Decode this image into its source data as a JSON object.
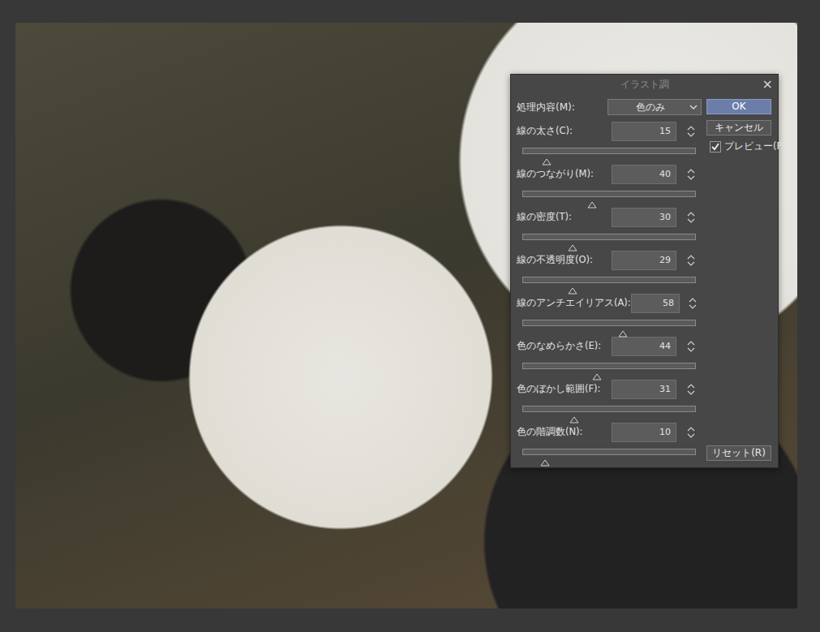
{
  "window": {
    "title": "イラスト調",
    "close": "×"
  },
  "mode": {
    "label": "処理内容(M):",
    "value": "色のみ"
  },
  "sliders": [
    {
      "label": "線の太さ(C):",
      "value": "15",
      "level": 0.14
    },
    {
      "label": "線のつながり(M):",
      "value": "40",
      "level": 0.4
    },
    {
      "label": "線の密度(T):",
      "value": "30",
      "level": 0.29
    },
    {
      "label": "線の不透明度(O):",
      "value": "29",
      "level": 0.29
    },
    {
      "label": "線のアンチエイリアス(A):",
      "value": "58",
      "level": 0.58
    },
    {
      "label": "色のなめらかさ(E):",
      "value": "44",
      "level": 0.43
    },
    {
      "label": "色のぼかし範囲(F):",
      "value": "31",
      "level": 0.3
    },
    {
      "label": "色の階調数(N):",
      "value": "10",
      "level": 0.13
    }
  ],
  "buttons": [
    {
      "label": "OK",
      "default": true
    },
    {
      "label": "キャンセル",
      "default": false
    }
  ],
  "preview": {
    "label": "プレビュー(P)",
    "checked": true
  },
  "reset": {
    "label": "リセット(R)"
  }
}
